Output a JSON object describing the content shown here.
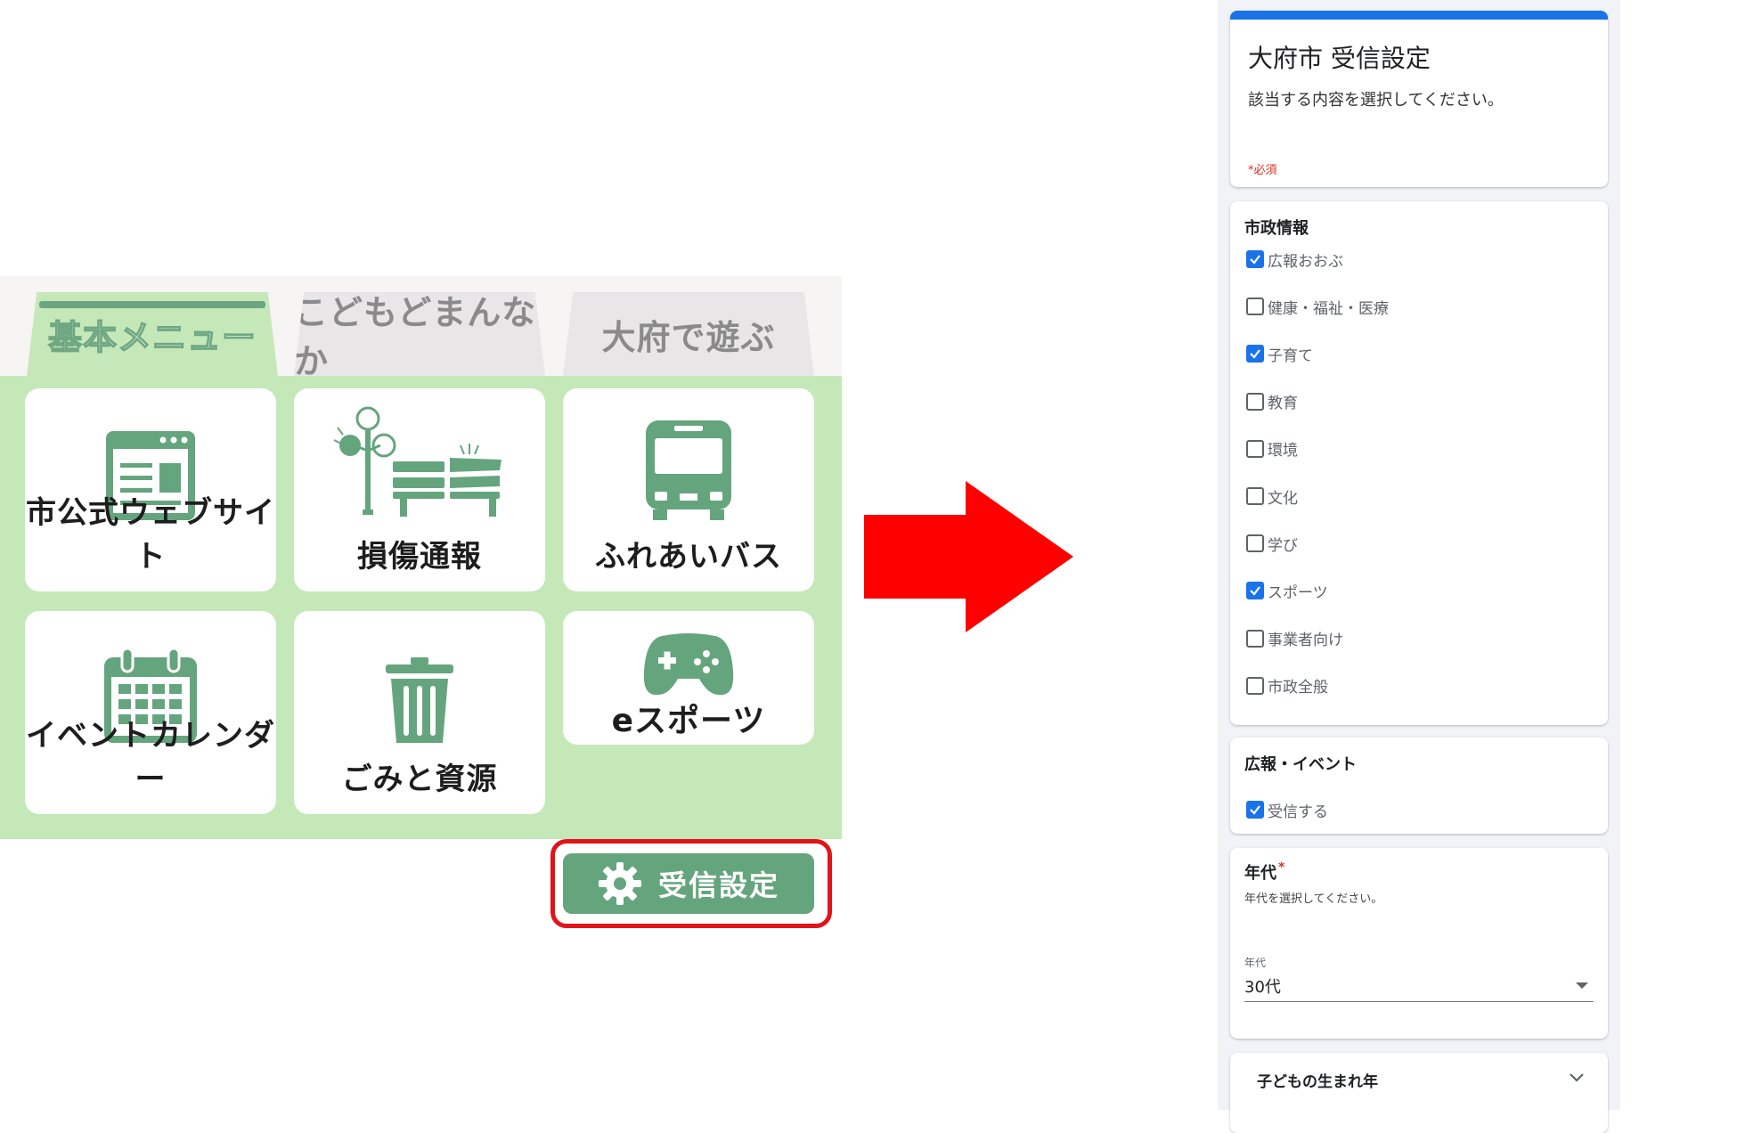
{
  "app": {
    "tabs": [
      {
        "label": "基本メニュー",
        "active": true
      },
      {
        "label": "こどもどまんなか",
        "active": false
      },
      {
        "label": "大府で遊ぶ",
        "active": false
      }
    ],
    "tiles": {
      "web": {
        "label": "市公式ウェブサイト",
        "icon": "browser-icon"
      },
      "damage": {
        "label": "損傷通報",
        "icon": "broken-bench-icon"
      },
      "bus": {
        "label": "ふれあいバス",
        "icon": "bus-icon"
      },
      "event": {
        "label": "イベントカレンダー",
        "icon": "calendar-icon"
      },
      "gomi": {
        "label": "ごみと資源",
        "icon": "trash-icon"
      },
      "esports": {
        "label": "eスポーツ",
        "icon": "gamepad-icon"
      }
    },
    "settings_button": {
      "label": "受信設定",
      "icon": "gear-icon"
    },
    "colors": {
      "accent_green": "#65a57e",
      "panel_green": "#c5e8b9",
      "highlight_red": "#e0141a",
      "arrow_red": "#ff0000"
    }
  },
  "form": {
    "title": "大府市 受信設定",
    "description": "該当する内容を選択してください。",
    "required_note": "*必須",
    "shisei": {
      "title": "市政情報",
      "options": [
        {
          "label": "広報おおぶ",
          "checked": true
        },
        {
          "label": "健康・福祉・医療",
          "checked": false
        },
        {
          "label": "子育て",
          "checked": true
        },
        {
          "label": "教育",
          "checked": false
        },
        {
          "label": "環境",
          "checked": false
        },
        {
          "label": "文化",
          "checked": false
        },
        {
          "label": "学び",
          "checked": false
        },
        {
          "label": "スポーツ",
          "checked": true
        },
        {
          "label": "事業者向け",
          "checked": false
        },
        {
          "label": "市政全般",
          "checked": false
        }
      ]
    },
    "kouhou": {
      "title": "広報・イベント",
      "options": [
        {
          "label": "受信する",
          "checked": true
        }
      ]
    },
    "nendai": {
      "title": "年代",
      "required_mark": "*",
      "description": "年代を選択してください。",
      "field_label": "年代",
      "selected": "30代"
    },
    "birth": {
      "title": "子どもの生まれ年"
    },
    "colors": {
      "accent_blue": "#1a73e8",
      "required_red": "#d93025"
    }
  }
}
